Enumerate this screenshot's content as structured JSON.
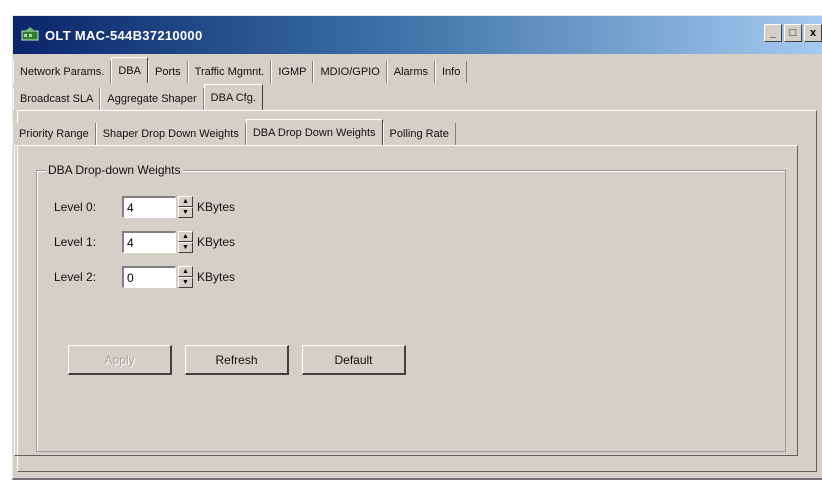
{
  "window": {
    "title": "OLT MAC-544B37210000",
    "icon": "network-device-icon",
    "controls": [
      "_",
      "□",
      "x"
    ]
  },
  "tabs_main": [
    {
      "label": "Network Params.",
      "active": false
    },
    {
      "label": "DBA",
      "active": true
    },
    {
      "label": "Ports",
      "active": false
    },
    {
      "label": "Traffic Mgmnt.",
      "active": false
    },
    {
      "label": "IGMP",
      "active": false
    },
    {
      "label": "MDIO/GPIO",
      "active": false
    },
    {
      "label": "Alarms",
      "active": false
    },
    {
      "label": "Info",
      "active": false
    }
  ],
  "tabs_dba": [
    {
      "label": "Broadcast SLA",
      "active": false
    },
    {
      "label": "Aggregate Shaper",
      "active": false
    },
    {
      "label": "DBA Cfg.",
      "active": true
    }
  ],
  "tabs_cfg": [
    {
      "label": "Priority Range",
      "active": false
    },
    {
      "label": "Shaper Drop Down Weights",
      "active": false
    },
    {
      "label": "DBA Drop Down Weights",
      "active": true
    },
    {
      "label": "Polling Rate",
      "active": false
    }
  ],
  "group": {
    "title": "DBA Drop-down Weights",
    "fields": [
      {
        "label": "Level 0:",
        "value": "4",
        "unit": "KBytes"
      },
      {
        "label": "Level 1:",
        "value": "4",
        "unit": "KBytes"
      },
      {
        "label": "Level 2:",
        "value": "0",
        "unit": "KBytes"
      }
    ]
  },
  "buttons": {
    "apply": "Apply",
    "refresh": "Refresh",
    "default": "Default"
  }
}
